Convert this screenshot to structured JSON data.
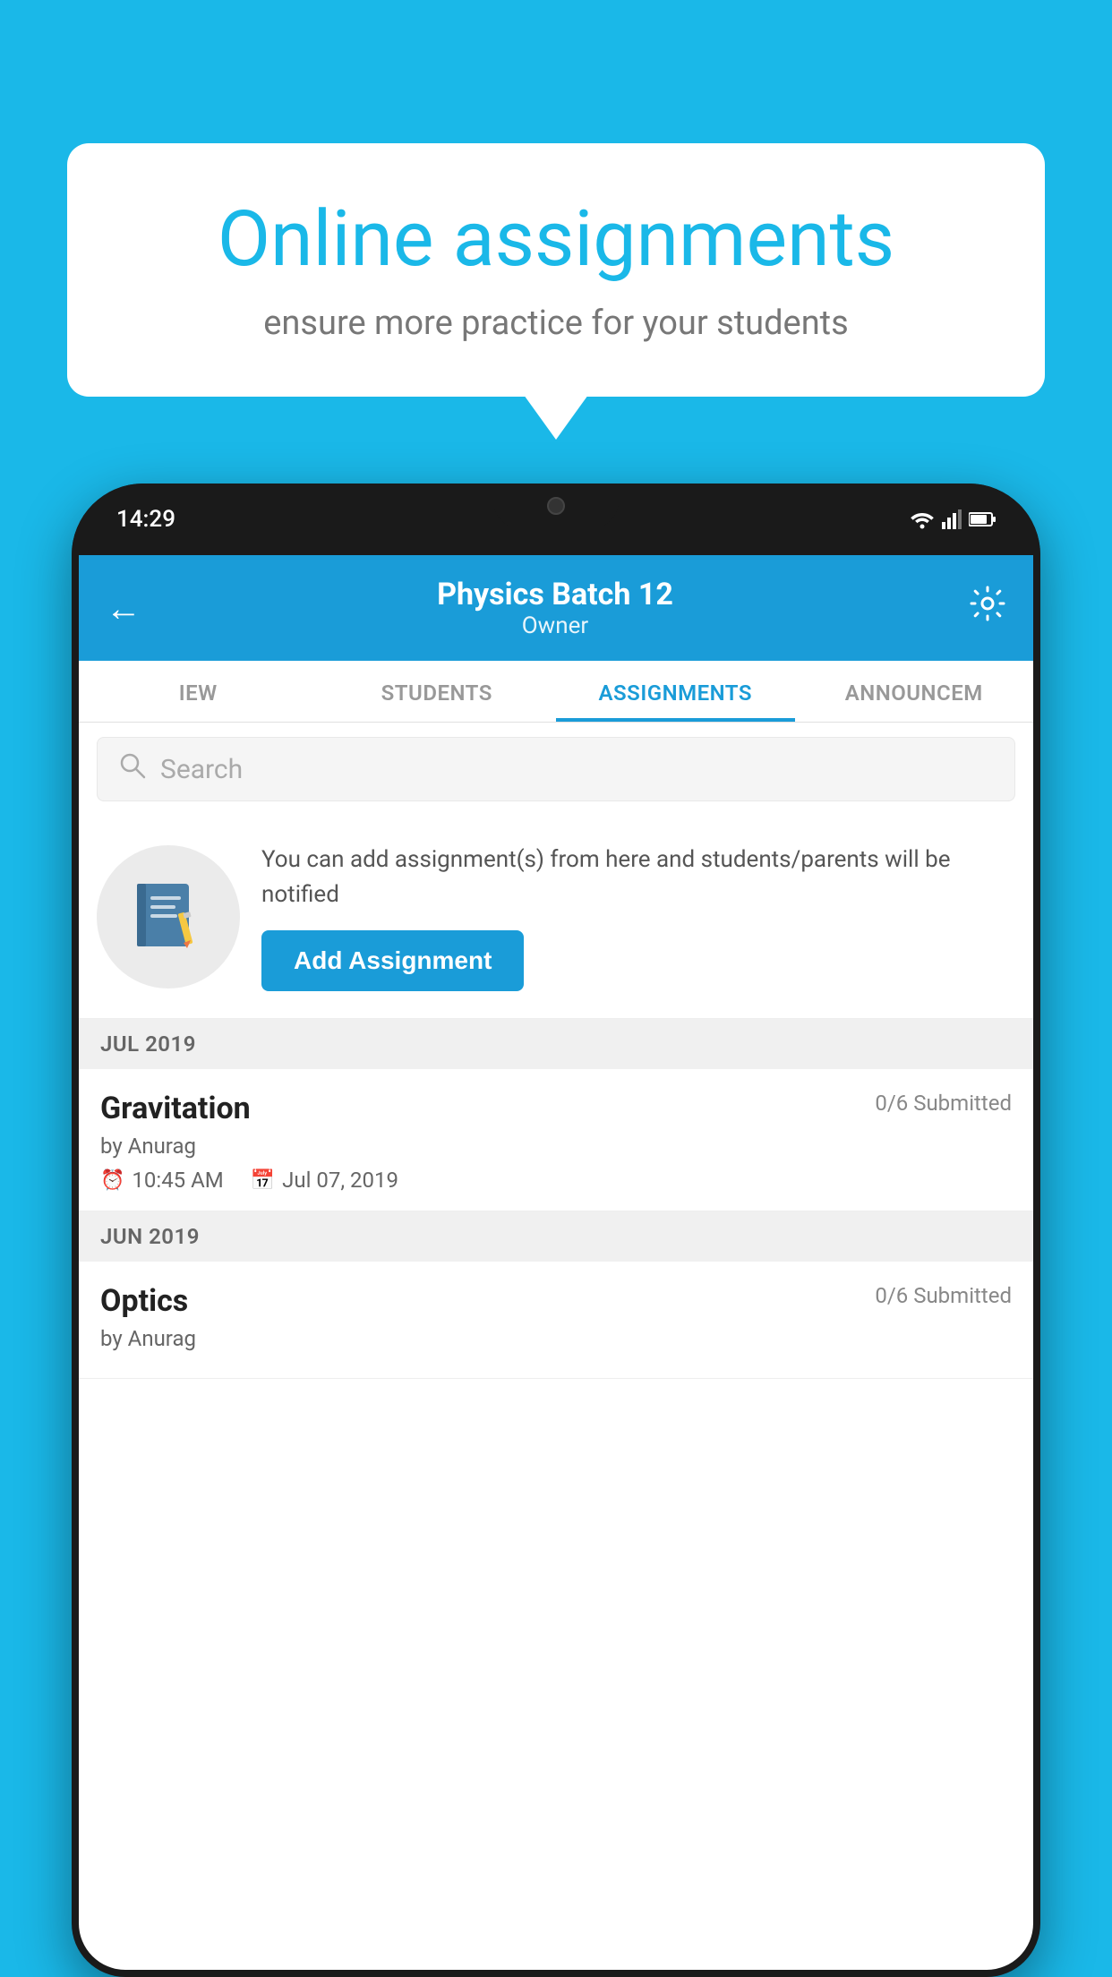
{
  "background": {
    "color": "#1ab8e8"
  },
  "speech_bubble": {
    "title": "Online assignments",
    "subtitle": "ensure more practice for your students"
  },
  "phone": {
    "status_bar": {
      "time": "14:29"
    },
    "header": {
      "title": "Physics Batch 12",
      "subtitle": "Owner"
    },
    "tabs": [
      {
        "label": "IEW",
        "active": false
      },
      {
        "label": "STUDENTS",
        "active": false
      },
      {
        "label": "ASSIGNMENTS",
        "active": true
      },
      {
        "label": "ANNOUNCEM",
        "active": false
      }
    ],
    "search": {
      "placeholder": "Search"
    },
    "empty_state": {
      "description": "You can add assignment(s) from here and students/parents will be notified",
      "button_label": "Add Assignment"
    },
    "sections": [
      {
        "month_label": "JUL 2019",
        "assignments": [
          {
            "name": "Gravitation",
            "submitted": "0/6 Submitted",
            "by": "by Anurag",
            "time": "10:45 AM",
            "date": "Jul 07, 2019"
          }
        ]
      },
      {
        "month_label": "JUN 2019",
        "assignments": [
          {
            "name": "Optics",
            "submitted": "0/6 Submitted",
            "by": "by Anurag",
            "time": "",
            "date": ""
          }
        ]
      }
    ]
  }
}
